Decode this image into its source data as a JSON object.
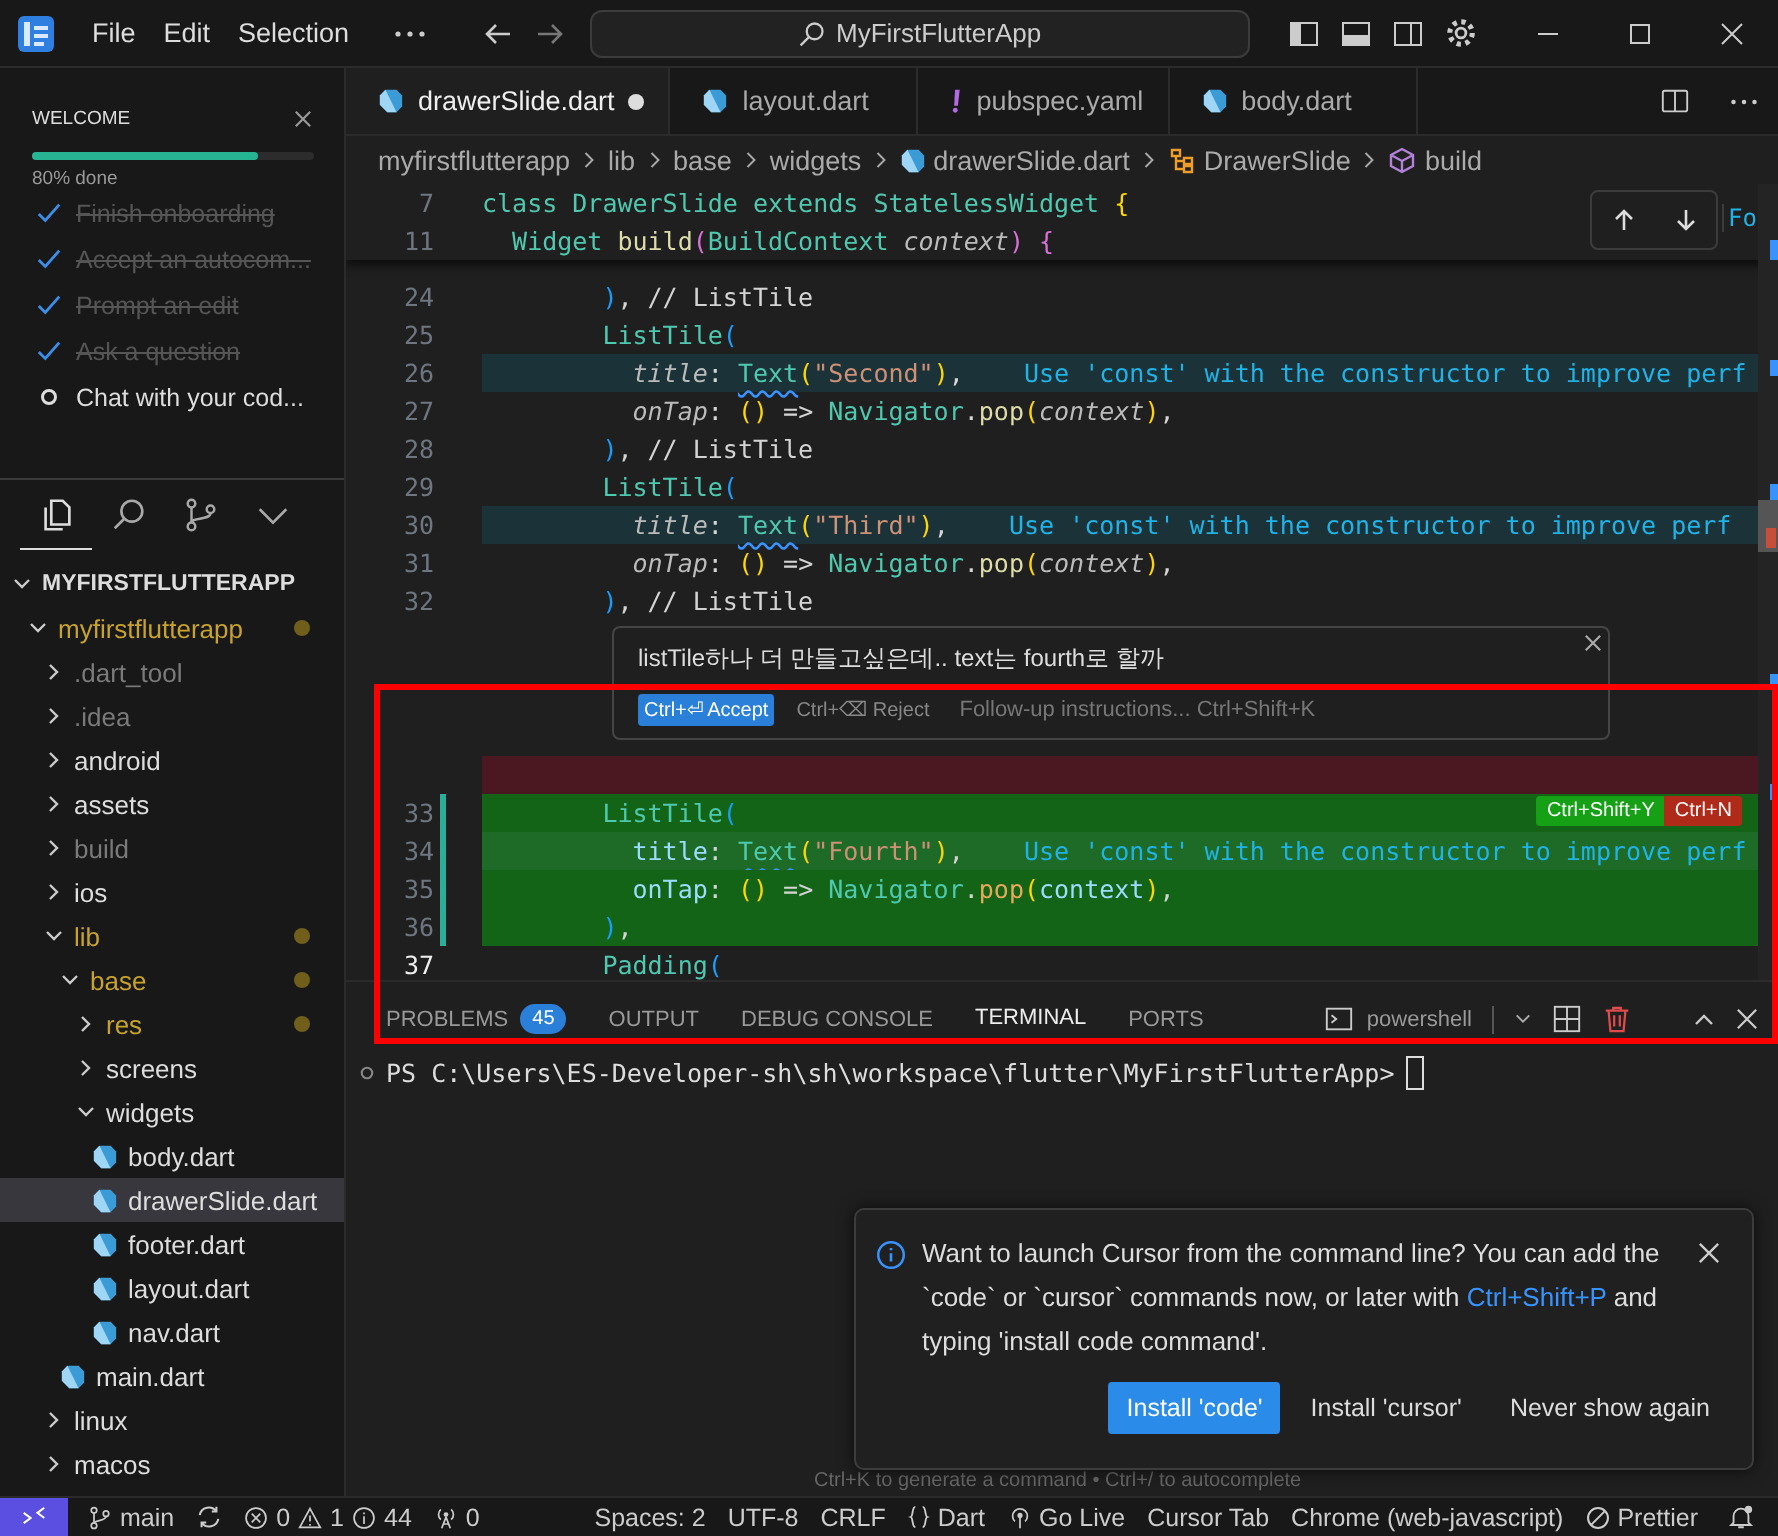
{
  "titlebar": {
    "menus": [
      "File",
      "Edit",
      "Selection"
    ],
    "search": "MyFirstFlutterApp"
  },
  "welcome": {
    "title": "WELCOME",
    "level": 0.8,
    "progress_text": "80% done",
    "items": [
      {
        "label": "Finish onboarding",
        "done": true
      },
      {
        "label": "Accept an autocom...",
        "done": true
      },
      {
        "label": "Prompt an edit",
        "done": true
      },
      {
        "label": "Ask a question",
        "done": true
      },
      {
        "label": "Chat with your cod...",
        "done": false
      }
    ]
  },
  "activity": [
    {
      "kind": "files",
      "selected": true
    },
    {
      "kind": "search",
      "selected": false
    },
    {
      "kind": "source-control",
      "selected": false
    },
    {
      "kind": "more",
      "selected": false
    }
  ],
  "explorer": {
    "tree": [
      {
        "label": "MYFIRSTFLUTTERAPP",
        "kind": "root",
        "expanded": true,
        "selected": false,
        "modified": false,
        "ignored": false,
        "children": [
          {
            "label": "myfirstflutterapp",
            "kind": "folder",
            "expanded": true,
            "selected": false,
            "modified": true,
            "ignored": false,
            "children": [
              {
                "label": ".dart_tool",
                "kind": "folder",
                "expanded": false,
                "selected": false,
                "modified": false,
                "ignored": true
              },
              {
                "label": ".idea",
                "kind": "folder",
                "expanded": false,
                "selected": false,
                "modified": false,
                "ignored": true
              },
              {
                "label": "android",
                "kind": "folder",
                "expanded": false,
                "selected": false,
                "modified": false,
                "ignored": false
              },
              {
                "label": "assets",
                "kind": "folder",
                "expanded": false,
                "selected": false,
                "modified": false,
                "ignored": false
              },
              {
                "label": "build",
                "kind": "folder",
                "expanded": false,
                "selected": false,
                "modified": false,
                "ignored": true
              },
              {
                "label": "ios",
                "kind": "folder",
                "expanded": false,
                "selected": false,
                "modified": false,
                "ignored": false
              },
              {
                "label": "lib",
                "kind": "folder",
                "expanded": true,
                "selected": false,
                "modified": true,
                "ignored": false,
                "children": [
                  {
                    "label": "base",
                    "kind": "folder",
                    "expanded": true,
                    "selected": false,
                    "modified": true,
                    "ignored": false,
                    "children": [
                      {
                        "label": "res",
                        "kind": "folder",
                        "expanded": false,
                        "selected": false,
                        "modified": true,
                        "ignored": false
                      },
                      {
                        "label": "screens",
                        "kind": "folder",
                        "expanded": false,
                        "selected": false,
                        "modified": false,
                        "ignored": false
                      },
                      {
                        "label": "widgets",
                        "kind": "folder",
                        "expanded": true,
                        "selected": false,
                        "modified": false,
                        "ignored": false,
                        "children": [
                          {
                            "label": "body.dart",
                            "kind": "file",
                            "selected": false,
                            "modified": false,
                            "ignored": false
                          },
                          {
                            "label": "drawerSlide.dart",
                            "kind": "file",
                            "selected": true,
                            "modified": false,
                            "ignored": false
                          },
                          {
                            "label": "footer.dart",
                            "kind": "file",
                            "selected": false,
                            "modified": false,
                            "ignored": false
                          },
                          {
                            "label": "layout.dart",
                            "kind": "file",
                            "selected": false,
                            "modified": false,
                            "ignored": false
                          },
                          {
                            "label": "nav.dart",
                            "kind": "file",
                            "selected": false,
                            "modified": false,
                            "ignored": false
                          }
                        ]
                      }
                    ]
                  },
                  {
                    "label": "main.dart",
                    "kind": "file",
                    "selected": false,
                    "modified": false,
                    "ignored": false
                  }
                ]
              },
              {
                "label": "linux",
                "kind": "folder",
                "expanded": false,
                "selected": false,
                "modified": false,
                "ignored": false
              },
              {
                "label": "macos",
                "kind": "folder",
                "expanded": false,
                "selected": false,
                "modified": false,
                "ignored": false
              }
            ]
          }
        ]
      }
    ]
  },
  "tabs": [
    {
      "label": "drawerSlide.dart",
      "kind": "dart",
      "selected": true,
      "dirty": true
    },
    {
      "label": "layout.dart",
      "kind": "dart",
      "selected": false,
      "dirty": false
    },
    {
      "label": "pubspec.yaml",
      "kind": "yaml",
      "selected": false,
      "dirty": false
    },
    {
      "label": "body.dart",
      "kind": "dart",
      "selected": false,
      "dirty": false
    }
  ],
  "breadcrumb": [
    {
      "label": "myfirstflutterapp",
      "kind": "folder"
    },
    {
      "label": "lib",
      "kind": "folder"
    },
    {
      "label": "base",
      "kind": "folder"
    },
    {
      "label": "widgets",
      "kind": "folder"
    },
    {
      "label": "drawerSlide.dart",
      "kind": "file"
    },
    {
      "label": "DrawerSlide",
      "kind": "class"
    },
    {
      "label": "build",
      "kind": "method"
    }
  ],
  "editor": {
    "edge_label": "Fo",
    "sticky_lines": [
      {
        "number": "7",
        "tokens": [
          {
            "text": "class ",
            "kind": "kw"
          },
          {
            "text": "DrawerSlide ",
            "kind": "type"
          },
          {
            "text": "extends ",
            "kind": "kw"
          },
          {
            "text": "StatelessWidget ",
            "kind": "type"
          },
          {
            "text": "{",
            "kind": "p1"
          }
        ]
      },
      {
        "number": "11",
        "tokens": [
          {
            "text": "  Widget ",
            "kind": "type"
          },
          {
            "text": "build",
            "kind": "fn"
          },
          {
            "text": "(",
            "kind": "p2"
          },
          {
            "text": "BuildContext ",
            "kind": "type"
          },
          {
            "text": "context",
            "kind": "param"
          },
          {
            "text": ") {",
            "kind": "p2"
          }
        ]
      }
    ],
    "lines": [
      {
        "number": "24",
        "kind": "normal",
        "tokens": [
          {
            "text": "        )",
            "kind": "p3"
          },
          {
            "text": ", // ListTile",
            "kind": "plain"
          }
        ]
      },
      {
        "number": "25",
        "kind": "normal",
        "tokens": [
          {
            "text": "        ListTile",
            "kind": "type"
          },
          {
            "text": "(",
            "kind": "p3"
          }
        ]
      },
      {
        "number": "26",
        "kind": "hint",
        "tokens": [
          {
            "text": "          title",
            "kind": "param"
          },
          {
            "text": ": ",
            "kind": "plain"
          },
          {
            "text": "Text",
            "kind": "warn"
          },
          {
            "text": "(",
            "kind": "p1"
          },
          {
            "text": "\"Second\"",
            "kind": "str"
          },
          {
            "text": ")",
            "kind": "p1"
          },
          {
            "text": ",    ",
            "kind": "plain"
          },
          {
            "text": "Use 'const' with the constructor to improve perf",
            "kind": "hint"
          }
        ]
      },
      {
        "number": "27",
        "kind": "normal",
        "tokens": [
          {
            "text": "          onTap",
            "kind": "param"
          },
          {
            "text": ": ",
            "kind": "plain"
          },
          {
            "text": "()",
            "kind": "p1"
          },
          {
            "text": " => ",
            "kind": "plain"
          },
          {
            "text": "Navigator",
            "kind": "type"
          },
          {
            "text": ".",
            "kind": "plain"
          },
          {
            "text": "pop",
            "kind": "fn"
          },
          {
            "text": "(",
            "kind": "p1"
          },
          {
            "text": "context",
            "kind": "param"
          },
          {
            "text": ")",
            "kind": "p1"
          },
          {
            "text": ",",
            "kind": "plain"
          }
        ]
      },
      {
        "number": "28",
        "kind": "normal",
        "tokens": [
          {
            "text": "        )",
            "kind": "p3"
          },
          {
            "text": ", // ListTile",
            "kind": "plain"
          }
        ]
      },
      {
        "number": "29",
        "kind": "normal",
        "tokens": [
          {
            "text": "        ListTile",
            "kind": "type"
          },
          {
            "text": "(",
            "kind": "p3"
          }
        ]
      },
      {
        "number": "30",
        "kind": "hint",
        "tokens": [
          {
            "text": "          title",
            "kind": "param"
          },
          {
            "text": ": ",
            "kind": "plain"
          },
          {
            "text": "Text",
            "kind": "warn"
          },
          {
            "text": "(",
            "kind": "p1"
          },
          {
            "text": "\"Third\"",
            "kind": "str"
          },
          {
            "text": ")",
            "kind": "p1"
          },
          {
            "text": ",    ",
            "kind": "plain"
          },
          {
            "text": "Use 'const' with the constructor to improve perf",
            "kind": "hint"
          }
        ]
      },
      {
        "number": "31",
        "kind": "normal",
        "tokens": [
          {
            "text": "          onTap",
            "kind": "param"
          },
          {
            "text": ": ",
            "kind": "plain"
          },
          {
            "text": "()",
            "kind": "p1"
          },
          {
            "text": " => ",
            "kind": "plain"
          },
          {
            "text": "Navigator",
            "kind": "type"
          },
          {
            "text": ".",
            "kind": "plain"
          },
          {
            "text": "pop",
            "kind": "fn"
          },
          {
            "text": "(",
            "kind": "p1"
          },
          {
            "text": "context",
            "kind": "param"
          },
          {
            "text": ")",
            "kind": "p1"
          },
          {
            "text": ",",
            "kind": "plain"
          }
        ]
      },
      {
        "number": "32",
        "kind": "normal",
        "tokens": [
          {
            "text": "        )",
            "kind": "p3"
          },
          {
            "text": ", // ListTile",
            "kind": "plain"
          }
        ]
      },
      {
        "kind": "prompt"
      },
      {
        "kind": "removed"
      },
      {
        "number": "33",
        "kind": "added",
        "actions": [
          {
            "label": "Ctrl+Shift+Y",
            "kind": "accept"
          },
          {
            "label": "Ctrl+N",
            "kind": "reject"
          }
        ],
        "tokens": [
          {
            "text": "        ListTile",
            "kind": "type"
          },
          {
            "text": "(",
            "kind": "p3"
          }
        ]
      },
      {
        "number": "34",
        "kind": "added-hint",
        "tokens": [
          {
            "text": "          title",
            "kind": "field"
          },
          {
            "text": ": ",
            "kind": "plain"
          },
          {
            "text": "Text",
            "kind": "warn"
          },
          {
            "text": "(",
            "kind": "p1"
          },
          {
            "text": "\"Fourth\"",
            "kind": "str"
          },
          {
            "text": ")",
            "kind": "p1"
          },
          {
            "text": ",    ",
            "kind": "plain"
          },
          {
            "text": "Use 'const' with the constructor to improve perf",
            "kind": "hint"
          }
        ]
      },
      {
        "number": "35",
        "kind": "added",
        "tokens": [
          {
            "text": "          onTap",
            "kind": "field"
          },
          {
            "text": ": ",
            "kind": "plain"
          },
          {
            "text": "()",
            "kind": "p1"
          },
          {
            "text": " => ",
            "kind": "plain"
          },
          {
            "text": "Navigator",
            "kind": "type"
          },
          {
            "text": ".",
            "kind": "plain"
          },
          {
            "text": "pop",
            "kind": "fn"
          },
          {
            "text": "(",
            "kind": "p1"
          },
          {
            "text": "context",
            "kind": "field"
          },
          {
            "text": ")",
            "kind": "p1"
          },
          {
            "text": ",",
            "kind": "plain"
          }
        ]
      },
      {
        "number": "36",
        "kind": "added",
        "tokens": [
          {
            "text": "        )",
            "kind": "p3"
          },
          {
            "text": ",",
            "kind": "plain"
          }
        ]
      },
      {
        "number": "37",
        "kind": "current",
        "tokens": [
          {
            "text": "        Padding",
            "kind": "type"
          },
          {
            "text": "(",
            "kind": "p3"
          }
        ]
      }
    ],
    "inline_prompt": {
      "text": "listTile하나 더 만들고싶은데.. text는 fourth로 할까",
      "actions": [
        {
          "label": "Ctrl+⏎ Accept",
          "kind": "primary"
        },
        {
          "label": "Ctrl+⌫ Reject",
          "kind": "secondary"
        }
      ],
      "placeholder": "Follow-up instructions... Ctrl+Shift+K"
    }
  },
  "panel": {
    "tabs": [
      {
        "label": "PROBLEMS",
        "badge": "45",
        "selected": false
      },
      {
        "label": "OUTPUT",
        "selected": false
      },
      {
        "label": "DEBUG CONSOLE",
        "selected": false
      },
      {
        "label": "TERMINAL",
        "selected": true
      },
      {
        "label": "PORTS",
        "selected": false
      }
    ],
    "terminal_name": "powershell",
    "prompt": "PS C:\\Users\\ES-Developer-sh\\sh\\workspace\\flutter\\MyFirstFlutterApp>",
    "hint": "Ctrl+K to generate a command • Ctrl+/ to autocomplete"
  },
  "notification": {
    "before": "Want to launch Cursor from the command line? You can add the `code` or `cursor` commands now, or later with ",
    "link": "Ctrl+Shift+P",
    "after": " and typing 'install code command'.",
    "buttons": [
      {
        "label": "Install 'code'",
        "kind": "primary"
      },
      {
        "label": "Install 'cursor'",
        "kind": "secondary"
      },
      {
        "label": "Never show again",
        "kind": "secondary"
      }
    ]
  },
  "status_bar": {
    "left": [
      {
        "kind": "remote"
      },
      {
        "kind": "branch",
        "text": "main"
      },
      {
        "kind": "sync"
      },
      {
        "kind": "problems",
        "errors": "0",
        "warnings": "1",
        "infos": "44"
      },
      {
        "kind": "ports",
        "text": "0"
      }
    ],
    "right": [
      {
        "kind": "text",
        "text": "Spaces: 2"
      },
      {
        "kind": "text",
        "text": "UTF-8"
      },
      {
        "kind": "text",
        "text": "CRLF"
      },
      {
        "kind": "language",
        "text": "Dart"
      },
      {
        "kind": "live",
        "text": "Go Live"
      },
      {
        "kind": "text",
        "text": "Cursor Tab"
      },
      {
        "kind": "text",
        "text": "Chrome (web-javascript)"
      },
      {
        "kind": "prettier",
        "text": "Prettier"
      },
      {
        "kind": "bell"
      }
    ]
  }
}
